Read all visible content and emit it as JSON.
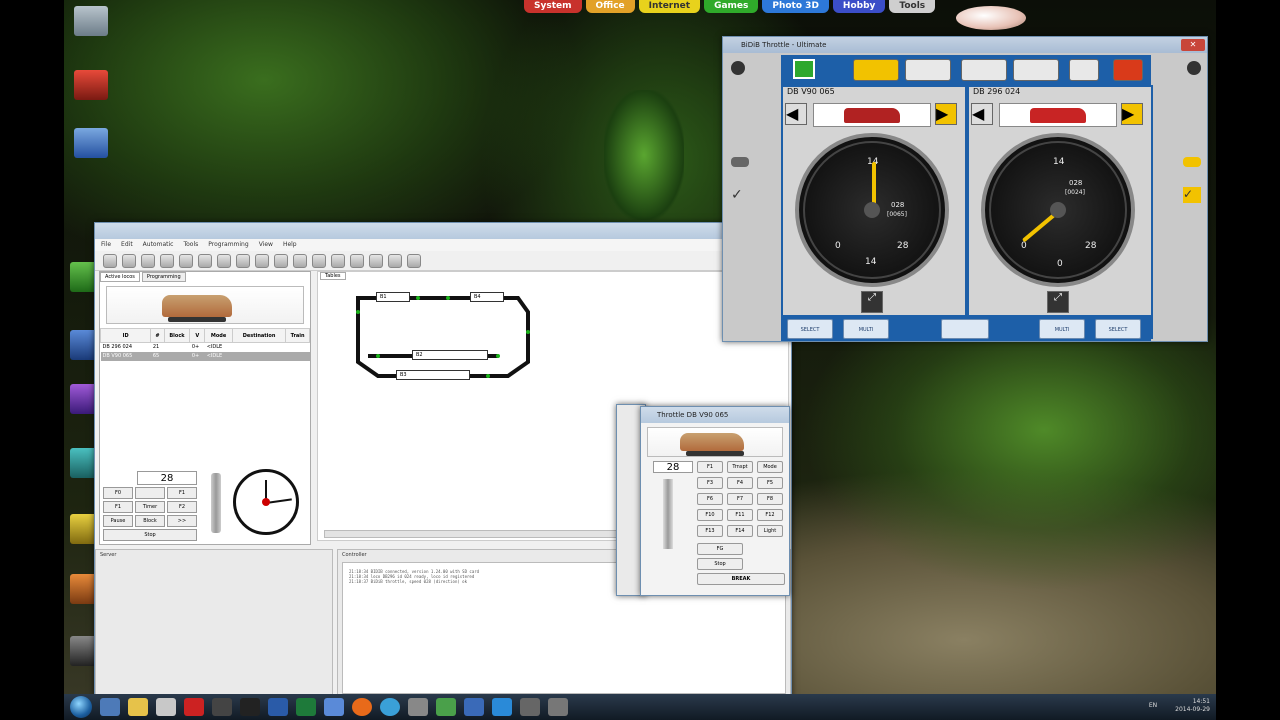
{
  "desktop_menu": [
    {
      "label": "System",
      "color": "#c8322c"
    },
    {
      "label": "Office",
      "color": "#e2a128"
    },
    {
      "label": "Internet",
      "color": "#e8d21c"
    },
    {
      "label": "Games",
      "color": "#2faa2a"
    },
    {
      "label": "Photo 3D",
      "color": "#2d78d8"
    },
    {
      "label": "Hobby",
      "color": "#3b4ec8"
    },
    {
      "label": "Tools",
      "color": "#cfcfcf"
    }
  ],
  "rocrail": {
    "menu": [
      "File",
      "Edit",
      "Automatic",
      "Tools",
      "Programming",
      "View",
      "Help"
    ],
    "tabs": [
      "Active locos",
      "Programming"
    ],
    "table_headers": [
      "ID",
      "#",
      "Block",
      "V",
      "Mode",
      "Destination",
      "Train"
    ],
    "rows": [
      [
        "DB 296 024",
        "21",
        "",
        "0+",
        "<IDLE"
      ],
      [
        "DB V90 065",
        "65",
        "",
        "0+",
        "<IDLE"
      ]
    ],
    "speed": "28",
    "controls_row1": [
      "F0",
      "",
      "F1"
    ],
    "controls_row2": [
      "F1",
      "Timer",
      "F2"
    ],
    "controls_row3": [
      "Pause",
      "Block",
      ">>"
    ],
    "stop_label": "Stop",
    "plan_tab": "Tables",
    "blocks": [
      "B1",
      "B4",
      "B2",
      "B3"
    ],
    "bottom_left_label": "Server",
    "bottom_right_label": "Controller",
    "console_lines": [
      "21:18:34 BIDIB connected, version 1.24.00 with SD card",
      "21:18:34 loco DB296 id 024 ready, loco id registered",
      "21:18:37 BiDiB throttle, speed 028 (direction) ok"
    ]
  },
  "bidib": {
    "title": "BiDiB Throttle - Ultimate",
    "left_loco": "DB V90 065",
    "right_loco": "DB 296 024",
    "left_speed": "028",
    "left_speed_sub": "[0065]",
    "right_speed": "028",
    "right_speed_sub": "[0024]",
    "left_scale": {
      "top": "14",
      "left": "0",
      "right": "28",
      "bottom": "14"
    },
    "right_scale": {
      "top": "14",
      "left": "0",
      "right": "28",
      "bottom": "0"
    },
    "select_labels": [
      "SELECT",
      "MULTI",
      "MULTI",
      "SELECT"
    ],
    "top_buttons": [
      "light-icon",
      "sound-icon",
      "train-icon",
      "track-icon",
      "menu-icon",
      "emergency-icon"
    ]
  },
  "throttle2": {
    "title": "Throttle DB V90 065",
    "speed": "28",
    "keys": [
      [
        "F1",
        "Trnspt",
        "Mode"
      ],
      [
        "F3",
        "F4",
        "F5"
      ],
      [
        "F6",
        "F7",
        "F8"
      ],
      [
        "F10",
        "F11",
        "F12"
      ],
      [
        "F13",
        "F14",
        "Light"
      ]
    ],
    "fg_label": "FG",
    "stop_label": "Stop",
    "break_label": "BREAK"
  },
  "taskbar": {
    "lang": "EN",
    "time": "14:51",
    "date": "2014-09-29"
  }
}
